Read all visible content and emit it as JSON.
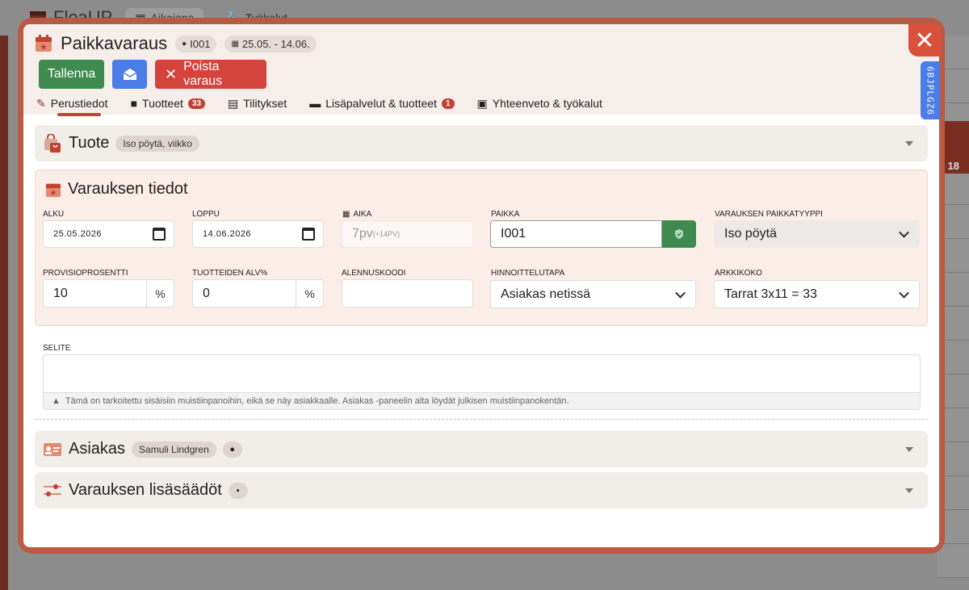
{
  "background": {
    "logo": "FleaUP",
    "tabs": [
      "Aikajana",
      "Työkalut"
    ],
    "row_number": "18"
  },
  "header": {
    "title": "Paikkavaraus",
    "place_chip": "I001",
    "date_chip": "25.05. - 14.06.",
    "save_label": "Tallenna",
    "delete_label": "Poista varaus",
    "side_tag": "6BJPLGZ6"
  },
  "tabs": [
    {
      "label": "Perustiedot",
      "icon": "pencil-icon"
    },
    {
      "label": "Tuotteet",
      "icon": "shopping-bag-icon",
      "badge": "33"
    },
    {
      "label": "Tilitykset",
      "icon": "receipt-icon"
    },
    {
      "label": "Lisäpalvelut & tuotteet",
      "icon": "wallet-icon",
      "badge": "1"
    },
    {
      "label": "Yhteenveto & työkalut",
      "icon": "calculator-icon"
    }
  ],
  "product_section": {
    "title": "Tuote",
    "chip": "Iso pöytä, viikko"
  },
  "details": {
    "title": "Varauksen tiedot",
    "alku": {
      "label": "ALKU",
      "value": "25.05.2026"
    },
    "loppu": {
      "label": "LOPPU",
      "value": "14.06.2026"
    },
    "aika": {
      "label": "AIKA",
      "value": "7pv",
      "extra": "(+14PV)"
    },
    "paikka": {
      "label": "PAIKKA",
      "value": "I001"
    },
    "paikkatyyppi": {
      "label": "VARAUKSEN PAIKKATYYPPI",
      "value": "Iso pöytä"
    },
    "provisio": {
      "label": "PROVISIOPROSENTTI",
      "value": "10",
      "suffix": "%"
    },
    "alv": {
      "label": "TUOTTEIDEN ALV%",
      "value": "0",
      "suffix": "%"
    },
    "alennus": {
      "label": "ALENNUSKOODI",
      "value": ""
    },
    "hinnoittelu": {
      "label": "HINNOITTELUTAPA",
      "value": "Asiakas netissä"
    },
    "arkkikoko": {
      "label": "ARKKIKOKO",
      "value": "Tarrat 3x11 = 33"
    }
  },
  "selite": {
    "label": "SELITE",
    "note": "Tämä on tarkoitettu sisäisiin muistiinpanoihin, eikä se näy asiakkaalle. Asiakas -paneelin alta löydät julkisen muistiinpanokentän."
  },
  "customer_section": {
    "title": "Asiakas",
    "chip": "Samuli Lindgren"
  },
  "extra_section": {
    "title": "Varauksen lisäsäädöt"
  },
  "colors": {
    "accent": "#c24232",
    "save": "#3f8a4e",
    "mail": "#4a7de8",
    "delete": "#d4443c",
    "frame": "#b85a44"
  }
}
